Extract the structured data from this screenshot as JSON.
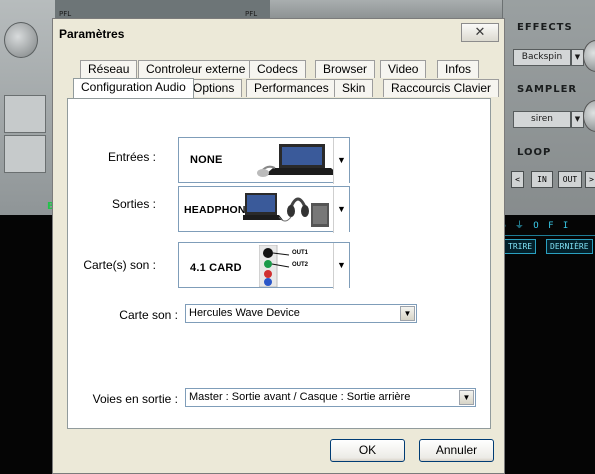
{
  "background_app": {
    "pfl_left": "PFL",
    "pfl_right": "PFL",
    "effects_label": "EFFECTS",
    "effects_value": "Backspin",
    "sampler_label": "SAMPLER",
    "sampler_value": "siren",
    "loop_label": "LOOP",
    "loop_buttons": [
      "<",
      "IN",
      "OUT",
      ">"
    ],
    "teal_row": "◉ ⏚   O F I",
    "teal_tabs": [
      "TRIRE",
      "DERNIÈRE"
    ],
    "green_letter": "B"
  },
  "dialog": {
    "title": "Paramètres",
    "close_symbol": "✕",
    "tabs_row1": [
      "Réseau",
      "Controleur externe",
      "Codecs",
      "Browser",
      "Video",
      "Infos"
    ],
    "tabs_row2": [
      "Configuration Audio",
      "Options",
      "Performances",
      "Skin",
      "Raccourcis Clavier"
    ],
    "active_tab": "Configuration Audio",
    "inputs_label": "Entrées :",
    "inputs_value": "NONE",
    "outputs_label": "Sorties :",
    "outputs_value": "HEADPHONES",
    "card_label": "Carte(s) son :",
    "card_value": "4.1 CARD",
    "card_out1": "OUT1",
    "card_out2": "OUT2",
    "soundcard_label": "Carte son :",
    "soundcard_value": "Hercules Wave Device",
    "channels_label": "Voies en sortie :",
    "channels_value": "Master : Sortie avant / Casque : Sortie arrière",
    "ok_label": "OK",
    "cancel_label": "Annuler",
    "dropdown_arrow": "▼"
  }
}
